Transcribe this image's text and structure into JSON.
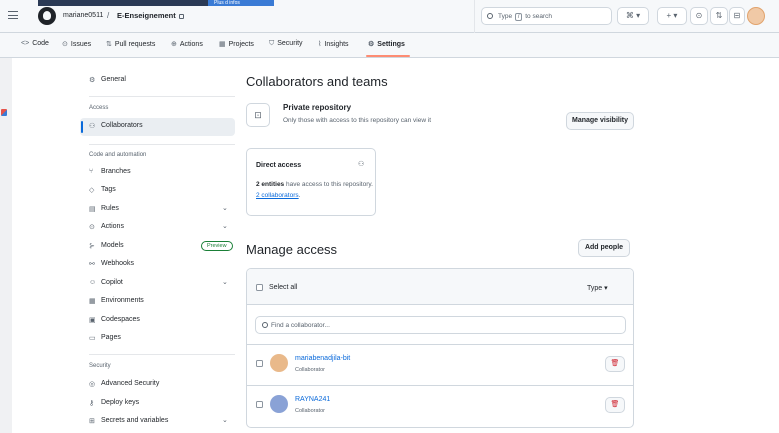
{
  "header": {
    "owner": "mariane0511",
    "separator": "/",
    "repo": "E-Enseignement",
    "overlay_tab": "Plus d infos",
    "search_prefix": "Type",
    "search_key": "/",
    "search_suffix": "to search",
    "btn_terminal": "⌘ ▾",
    "btn_plus": "+ ▾",
    "btn_issues": "⊙",
    "btn_pulls": "⇅",
    "btn_inbox": "⊟"
  },
  "repo_nav": [
    {
      "icon": "<>",
      "label": "Code"
    },
    {
      "icon": "⊙",
      "label": "Issues"
    },
    {
      "icon": "⇅",
      "label": "Pull requests"
    },
    {
      "icon": "⊕",
      "label": "Actions"
    },
    {
      "icon": "▦",
      "label": "Projects"
    },
    {
      "icon": "⛉",
      "label": "Security"
    },
    {
      "icon": "⌇",
      "label": "Insights"
    },
    {
      "icon": "⚙",
      "label": "Settings"
    }
  ],
  "sidebar": {
    "general": {
      "icon": "⚙",
      "label": "General"
    },
    "section_access": "Access",
    "collaborators": {
      "icon": "⚇",
      "label": "Collaborators"
    },
    "section_code": "Code and automation",
    "branches": {
      "icon": "⑂",
      "label": "Branches"
    },
    "tags": {
      "icon": "◇",
      "label": "Tags"
    },
    "rules": {
      "icon": "▤",
      "label": "Rules"
    },
    "actions": {
      "icon": "⊙",
      "label": "Actions"
    },
    "models": {
      "icon": "⊱",
      "label": "Models",
      "badge": "Preview"
    },
    "webhooks": {
      "icon": "⚯",
      "label": "Webhooks"
    },
    "copilot": {
      "icon": "☺",
      "label": "Copilot"
    },
    "environments": {
      "icon": "▦",
      "label": "Environments"
    },
    "codespaces": {
      "icon": "▣",
      "label": "Codespaces"
    },
    "pages": {
      "icon": "▭",
      "label": "Pages"
    },
    "section_security": "Security",
    "advanced_security": {
      "icon": "◎",
      "label": "Advanced Security"
    },
    "deploy_keys": {
      "icon": "⚷",
      "label": "Deploy keys"
    },
    "secrets": {
      "icon": "⊞",
      "label": "Secrets and variables"
    },
    "chevron": "⌄"
  },
  "main": {
    "title": "Collaborators and teams",
    "visibility": {
      "lock": "⊡",
      "title": "Private repository",
      "subtitle": "Only those with access to this repository can view it",
      "button": "Manage visibility"
    },
    "direct": {
      "title": "Direct access",
      "icon": "⚇",
      "count": "2 entities",
      "text": "have access to this repository.",
      "link": "2 collaborators",
      "period": "."
    },
    "manage_title": "Manage access",
    "add_button": "Add people",
    "table": {
      "select_all": "Select all",
      "type": "Type ▾",
      "find_placeholder": "Find a collaborator...",
      "members": [
        {
          "username": "mariabenadjila-bit",
          "role": "Collaborator",
          "avatar_color": "#e9b98a",
          "delete_icon": "🗑"
        },
        {
          "username": "RAYNA241",
          "role": "Collaborator",
          "avatar_color": "#8aa2d6",
          "delete_icon": "🗑"
        }
      ]
    }
  }
}
